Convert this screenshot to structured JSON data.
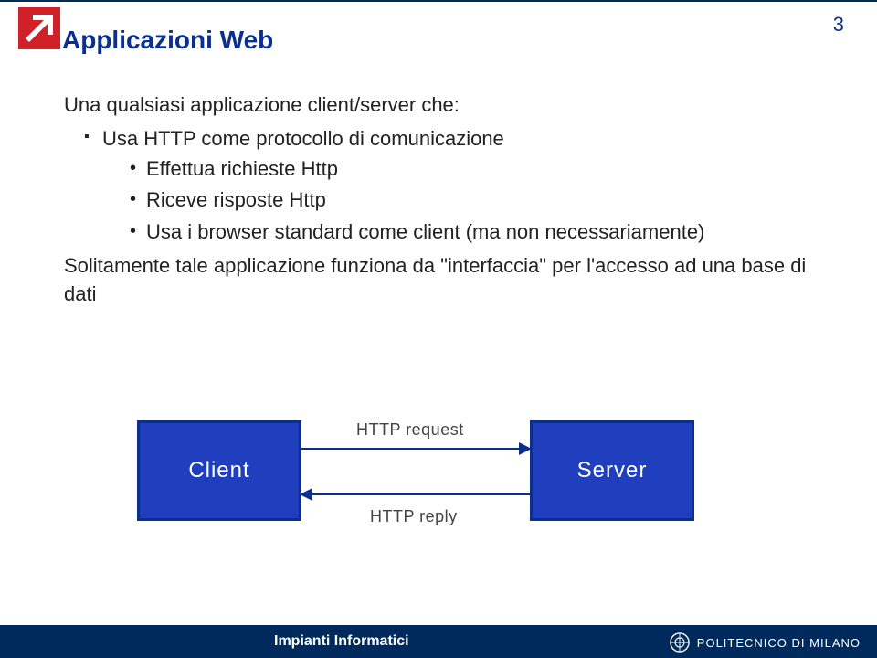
{
  "page_number": "3",
  "title": "Applicazioni Web",
  "lead": "Una qualsiasi applicazione client/server che:",
  "bullet1": "Usa HTTP come protocollo di comunicazione",
  "sub_bullets": [
    "Effettua richieste Http",
    "Riceve risposte Http",
    "Usa i browser standard come client (ma non necessariamente)"
  ],
  "closing": "Solitamente tale applicazione funziona da \"interfaccia\" per l'accesso ad una base di dati",
  "diagram": {
    "client": "Client",
    "server": "Server",
    "request_label": "HTTP request",
    "reply_label": "HTTP reply"
  },
  "footer": {
    "course": "Impianti Informatici",
    "institution": "POLITECNICO DI MILANO"
  }
}
